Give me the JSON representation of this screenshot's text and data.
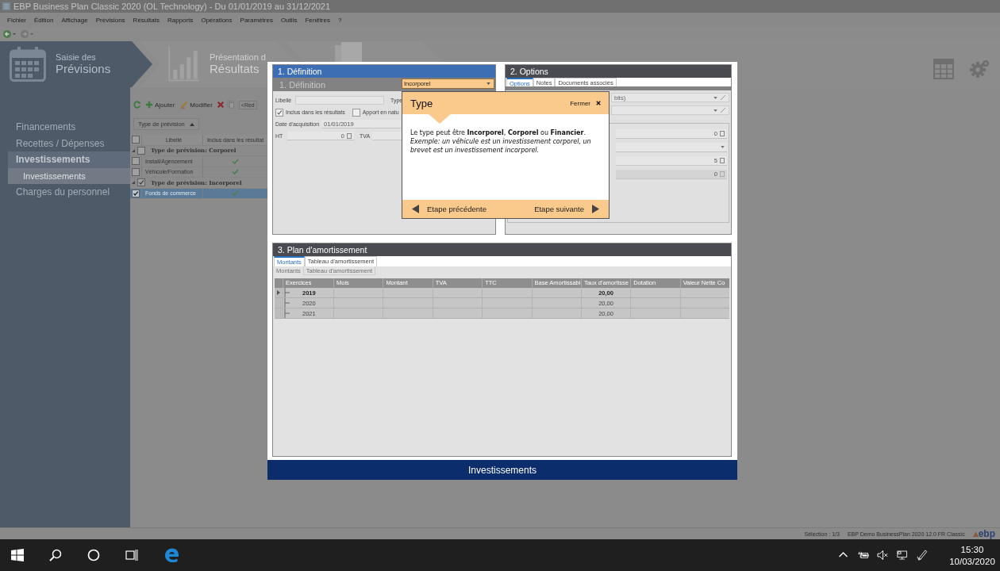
{
  "window": {
    "title": "EBP Business Plan Classic 2020 (OL Technology) - Du 01/01/2019 au 31/12/2021"
  },
  "menu": [
    "Fichier",
    "Édition",
    "Affichage",
    "Prévisions",
    "Résultats",
    "Rapports",
    "Opérations",
    "Paramètres",
    "Outils",
    "Fenêtres",
    "?"
  ],
  "steps": [
    {
      "kind": "calendar",
      "line1": "Saisie des",
      "line2": "Prévisions",
      "selected": true
    },
    {
      "kind": "chart",
      "line1": "Présentation d",
      "line2": "Résultats",
      "selected": false
    }
  ],
  "sidebar": {
    "items": [
      {
        "label": "Financements",
        "selected": false
      },
      {
        "label": "Recettes / Dépenses",
        "selected": false
      },
      {
        "label": "Investissements",
        "selected": true,
        "children": [
          {
            "label": "Investissements",
            "selected": true
          }
        ]
      },
      {
        "label": "Charges du personnel",
        "selected": false
      }
    ]
  },
  "list": {
    "toolbar": [
      "Ajouter",
      "Modifier",
      "<Red"
    ],
    "group_by": "Type de prévision",
    "all_checked": false,
    "columns": [
      "Libellé",
      "Inclus dans les résultat"
    ],
    "groups": [
      {
        "label": "Type de prévision: Corporel",
        "checked": false,
        "rows": [
          {
            "label": "Install/Agencement",
            "checked": false,
            "included": true,
            "selected": false
          },
          {
            "label": "Véhicule/Formation",
            "checked": false,
            "included": true,
            "selected": false
          }
        ]
      },
      {
        "label": "Type de prévision: Incorporel",
        "checked": true,
        "rows": [
          {
            "label": "Fonds de commerce",
            "checked": true,
            "included": true,
            "selected": true
          }
        ]
      }
    ]
  },
  "dialog": {
    "definition": {
      "title": "1. Définition",
      "subtitle": "1. Définition",
      "type_value": "Incorporel",
      "libelle_label": "Libellé",
      "type_label": "Type",
      "checks": [
        {
          "label": "Inclus dans les résultats",
          "checked": true
        },
        {
          "label": "Apport en natu",
          "checked": false
        }
      ],
      "date_label": "Date d'acquisition",
      "date_value": "01/01/2019",
      "ht_label": "HT",
      "ht_value": "0",
      "tva_label": "TVA"
    },
    "options": {
      "title": "2. Options",
      "tabs": [
        {
          "label": "Options",
          "selected": true
        },
        {
          "label": "Notes",
          "selected": false
        },
        {
          "label": "Documents associés",
          "selected": false
        }
      ],
      "combo_text": "bits)",
      "values": [
        "0",
        "5",
        "0"
      ]
    },
    "tooltip": {
      "title": "Type",
      "close": "Fermer",
      "text": "Le type peut être **Incorporel**, **Corporel** ou **Financier**.",
      "example": "Exemple: un véhicule est un investissement corporel, un brevet est un investissement incorporel.",
      "prev": "Etape précédente",
      "next": "Etape suivante"
    },
    "plan": {
      "title": "3. Plan d'amortissement",
      "tabs": [
        {
          "label": "Montants",
          "selected": true
        },
        {
          "label": "Tableau d'amortissement",
          "selected": false
        }
      ],
      "ghost_tabs": [
        "Montants",
        "Tableau d'amortissement"
      ],
      "columns": [
        "Exercices",
        "Mois",
        "Montant",
        "TVA",
        "TTC",
        "Base Amortissabl",
        "Taux d'amortisse",
        "Dotation",
        "Valeur Nette Co"
      ],
      "rows": [
        {
          "year": "2019",
          "rate": "20,00",
          "emphasis": true,
          "current": true
        },
        {
          "year": "2020",
          "rate": "20,00",
          "emphasis": false,
          "current": false
        },
        {
          "year": "2021",
          "rate": "20,00",
          "emphasis": false,
          "current": false
        }
      ]
    },
    "footer": "Investissements"
  },
  "status_bar": {
    "selection": "Sélection : 1/3",
    "product": "EBP Demo BusinessPlan 2020 12.0 FR Classic",
    "logo": "ebp"
  },
  "taskbar": {
    "time": "15:30",
    "date": "10/03/2020"
  }
}
